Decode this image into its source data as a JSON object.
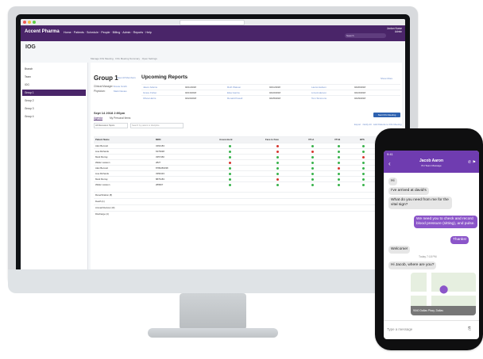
{
  "app": {
    "logo": "Accent Pharma",
    "nav_items": [
      "Home",
      "Patients",
      "Schedule",
      "People",
      "Billing",
      "Admin",
      "Reports",
      "Help"
    ],
    "title": "IOG",
    "user_lines": [
      "Jordan Nurse",
      "Admin"
    ],
    "search_placeholder": "Search"
  },
  "tabsline": [
    "Manage IOG Meeting",
    "IOG Meeting Summary",
    "Open Settings"
  ],
  "sidebar": [
    {
      "label": "Branch"
    },
    {
      "label": "Team"
    },
    {
      "label": "IOG"
    },
    {
      "label": "Group 1",
      "active": true
    },
    {
      "label": "Group 2"
    },
    {
      "label": "Group 3"
    },
    {
      "label": "Group 4"
    }
  ],
  "group": {
    "title": "Group 1",
    "link": "View All Members",
    "meta": [
      {
        "label": "Clinical Manager:",
        "value": "Nicole Smith"
      },
      {
        "label": "Physician:",
        "value": "Mark Davies"
      }
    ]
  },
  "upcoming": {
    "title": "Upcoming Reports",
    "link": "Show More",
    "rows": [
      [
        "Jason Adams",
        "04/11/2018",
        "Ruth Watson",
        "04/11/2018",
        "Laura Hudson",
        "04/20/2018"
      ],
      [
        "Grace Fisher",
        "04/13/2018",
        "Elsa Garcia",
        "04/22/2018",
        "Liza Anderson",
        "04/24/2018"
      ],
      [
        "Olivia Harris",
        "04/24/2018",
        "Ronald Powell",
        "04/25/2018",
        "Tom Simmons",
        "04/29/2018"
      ]
    ]
  },
  "meeting": {
    "date_line": "Sept 14 2018 2:00pm",
    "tabs": [
      "Agenda",
      "My Personal Items"
    ],
    "filter": "All Discussion Topics",
    "search_placeholder": "Search by patient or discipline",
    "button": "Start IOG Meeting",
    "links": [
      "Export",
      "Notify All",
      "Add Patients to IOG Meeting"
    ]
  },
  "table": {
    "headers": [
      "Patient Name",
      "MRN",
      "Assessment",
      "Face to Face",
      "VTI-A",
      "VTI-B",
      "BPS",
      "LOC"
    ],
    "rows": [
      {
        "name": "Alan Bennett",
        "mrn": "3462183"
      },
      {
        "name": "Lisa Richards",
        "mrn": "6379938"
      },
      {
        "name": "Mark Murray",
        "mrn": "3357450"
      },
      {
        "name": "Walter Lawson",
        "mrn": "2827"
      },
      {
        "name": "Alan Bennett",
        "mrn": "8789456338"
      },
      {
        "name": "Lisa Richards",
        "mrn": "3356433"
      },
      {
        "name": "Mark Murray",
        "mrn": "8879183"
      },
      {
        "name": "Walter Lawson",
        "mrn": "289967"
      }
    ],
    "sections": [
      "Reverification (8)",
      "Death (1)",
      "Annual Review (10)",
      "Discharge (4)"
    ]
  },
  "phone": {
    "time": "9:41",
    "name": "Jacob Aaron",
    "subtitle": "PH Team Message",
    "messages": [
      {
        "side": "left",
        "text": "Hi"
      },
      {
        "side": "left",
        "text": "I've arrived at david's"
      },
      {
        "side": "left",
        "text": "What do you need from me for the vital sign?"
      },
      {
        "side": "right",
        "text": "We need you to check and record blood pressure (sitting), and pulse."
      },
      {
        "side": "right",
        "text": "Thanks!"
      },
      {
        "side": "left",
        "text": "Welcome!"
      },
      {
        "side": "center",
        "text": "Today 7:18 PM"
      },
      {
        "side": "left",
        "text": "Hi Jacob, where are you?"
      }
    ],
    "map_caption": "9040 Dallas Pkwy, Dallas",
    "input_placeholder": "Type a message"
  },
  "colors": {
    "brand": "#4a2569",
    "phone_header": "#6f3cb0",
    "outgoing": "#8b55c9",
    "ok": "#38b24b",
    "alert": "#d6342e"
  }
}
